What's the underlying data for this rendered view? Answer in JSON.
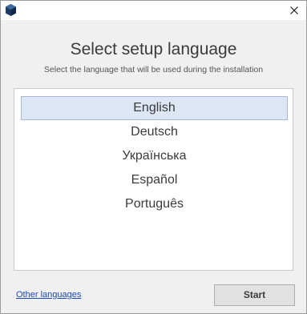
{
  "titlebar": {
    "app_icon": "cube-icon",
    "close_icon": "close-icon"
  },
  "dialog": {
    "title": "Select setup language",
    "subtitle": "Select the language that will be used during the installation"
  },
  "languages": {
    "items": [
      "English",
      "Deutsch",
      "Українська",
      "Español",
      "Português"
    ],
    "selected": "English"
  },
  "footer": {
    "other_languages_label": "Other languages",
    "start_label": "Start"
  },
  "colors": {
    "selection_bg": "#dce6f4",
    "selection_border": "#a9b9d5",
    "link": "#1e4bb5",
    "icon": "#1c3c66"
  }
}
